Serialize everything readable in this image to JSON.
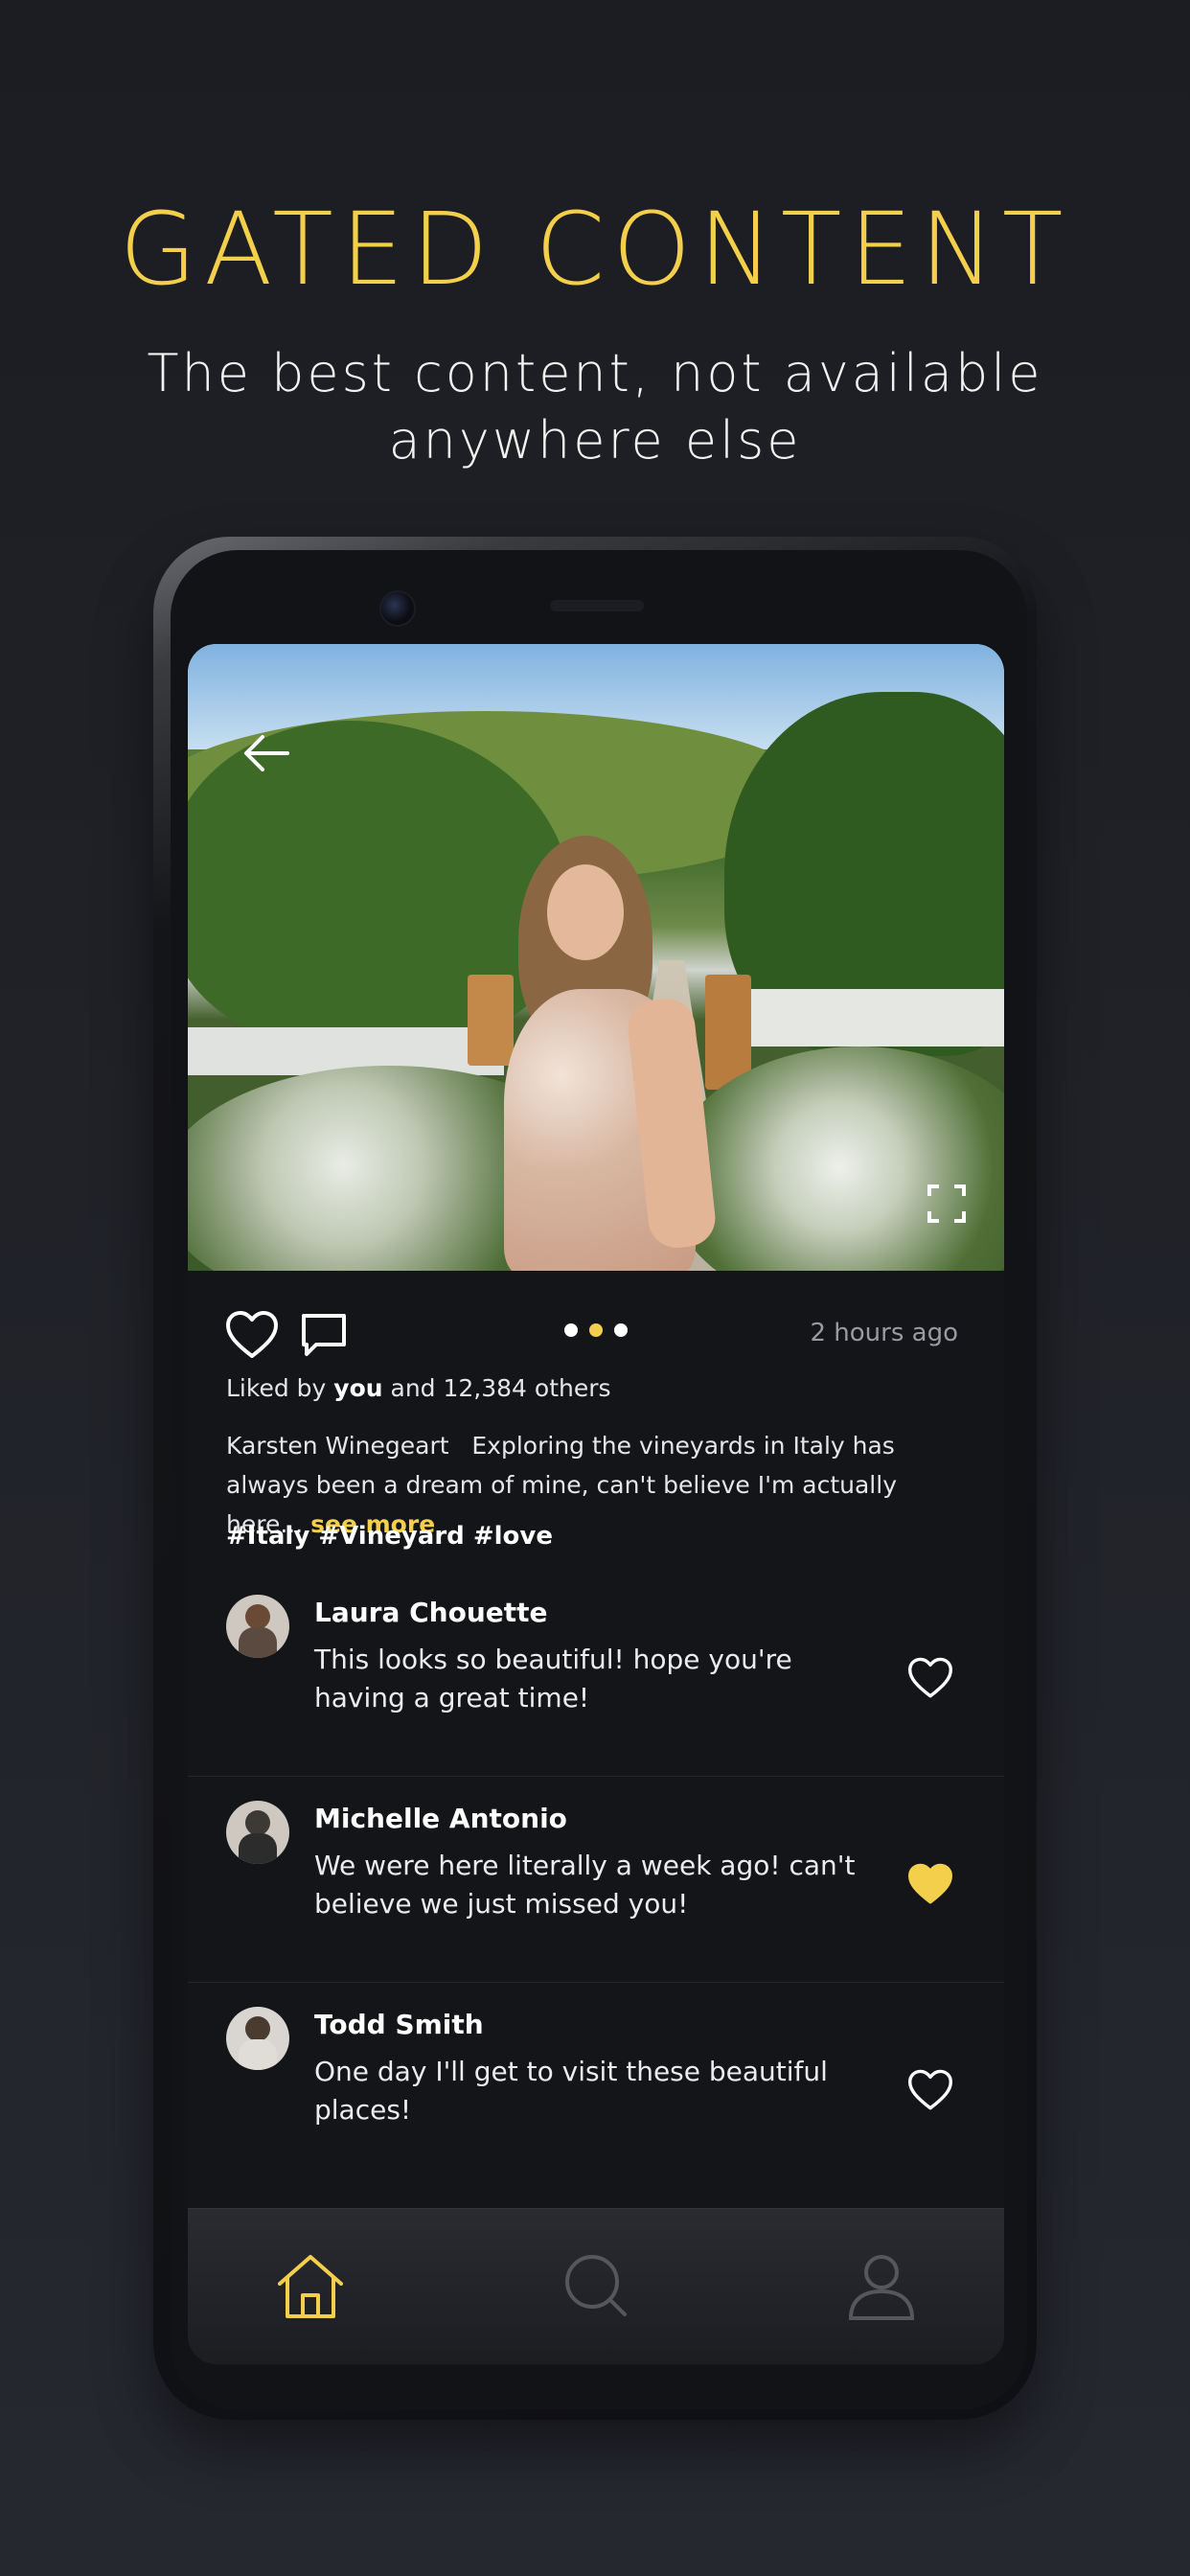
{
  "promo": {
    "headline": "GATED CONTENT",
    "subheadline": "The best content, not available anywhere else"
  },
  "post": {
    "time_ago": "2 hours ago",
    "carousel": {
      "count": 3,
      "active_index": 1
    },
    "likes": {
      "prefix": "Liked by ",
      "you": "you",
      "suffix": " and 12,384 others"
    },
    "caption": {
      "author": "Karsten Winegeart",
      "text": "Exploring the vineyards in Italy has always been a dream of mine, can't believe I'm actually here...",
      "see_more": "see more"
    },
    "hashtags": "#Italy #Vineyard #love"
  },
  "comments": [
    {
      "name": "Laura Chouette",
      "text": "This looks so beautiful! hope you're having a great time!",
      "liked": false
    },
    {
      "name": "Michelle Antonio",
      "text": "We were here literally a week ago! can't believe we just missed you!",
      "liked": true
    },
    {
      "name": "Todd Smith",
      "text": "One day I'll get to visit these beautiful places!",
      "liked": false
    }
  ],
  "tabbar": {
    "active": "home",
    "items": [
      "home-icon",
      "search-icon",
      "profile-icon"
    ]
  },
  "colors": {
    "accent": "#f4cf4c",
    "background": "#1c1d22",
    "inactive_icon": "#56575c"
  }
}
